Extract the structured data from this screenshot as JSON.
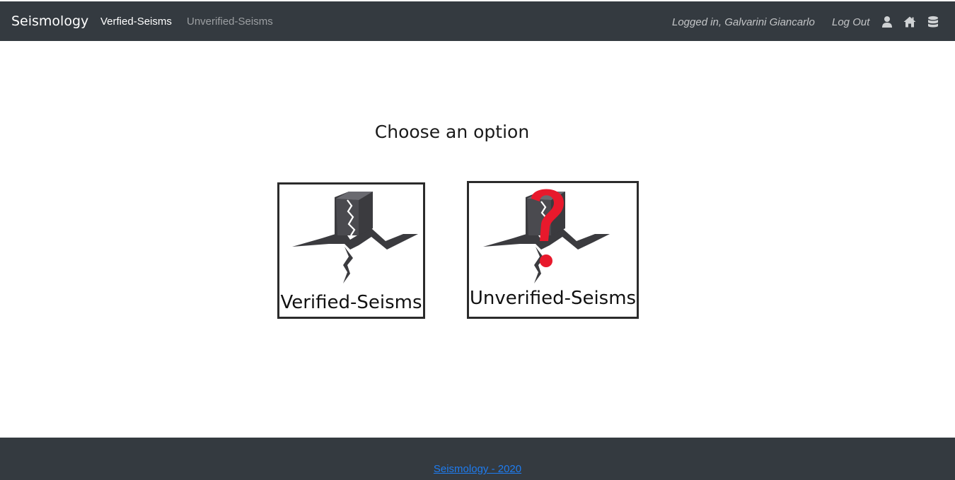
{
  "navbar": {
    "brand": "Seismology",
    "links": [
      {
        "label": "Verfied-Seisms",
        "active": true
      },
      {
        "label": "Unverified-Seisms",
        "active": false
      }
    ],
    "logged_in_text": "Logged in, Galvarini Giancarlo",
    "logout_label": "Log Out",
    "icons": [
      "user-icon",
      "home-icon",
      "database-icon"
    ]
  },
  "main": {
    "heading": "Choose an option",
    "options": [
      {
        "label": "Verified-Seisms",
        "icon": "earthquake-icon"
      },
      {
        "label": "Unverified-Seisms",
        "icon": "earthquake-question-icon"
      }
    ]
  },
  "footer": {
    "text": "Seismology - 2020"
  },
  "colors": {
    "navbar_bg": "#343a40",
    "footer_link": "#1e7cf0",
    "question_mark": "#e8192c"
  }
}
